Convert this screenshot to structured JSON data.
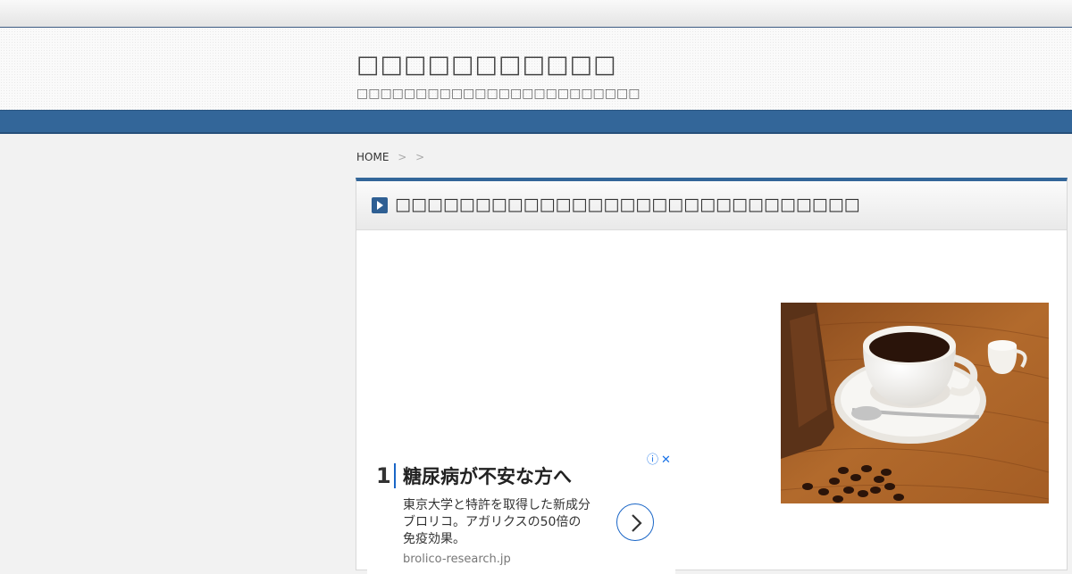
{
  "site": {
    "title": "□□□□□□□□□□□",
    "tagline": "□□□□□□□□□□□□□□□□□□□□□□□□"
  },
  "breadcrumb": {
    "home": "HOME",
    "separator": ">"
  },
  "article": {
    "title": "□□□□□□□□□□□□□□□□□□□□□□□□□□□□□"
  },
  "ad": {
    "info_icon": "ⓘ",
    "close_icon": "✕",
    "number": "1",
    "headline": "糖尿病が不安な方へ",
    "body_lines": [
      "東京大学と特許を取得した新成分",
      "ブロリコ。アガリクスの50倍の",
      "免疫効果。"
    ],
    "domain": "brolico-research.jp",
    "arrow_icon": "chevron-right-icon"
  },
  "image": {
    "subject": "coffee-cup-photo"
  },
  "colors": {
    "accent": "#336699",
    "ad_link": "#1a73e8"
  }
}
